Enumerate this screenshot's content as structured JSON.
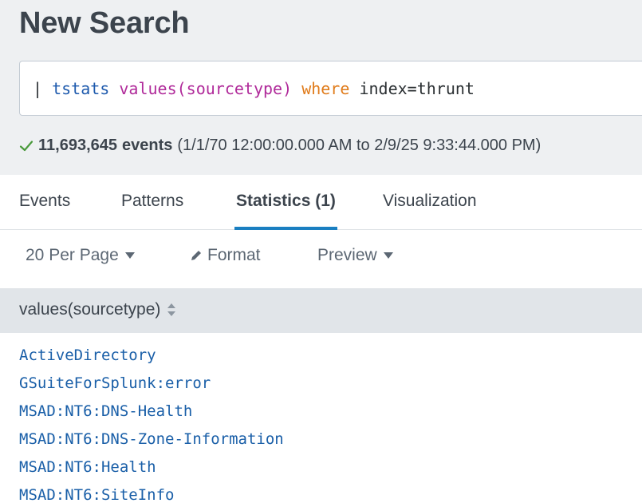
{
  "header": {
    "title": "New Search"
  },
  "search": {
    "pipe": "|",
    "command": "tstats",
    "function": "values(sourcetype)",
    "keyword": "where",
    "argument": "index=thrunt"
  },
  "status": {
    "count": "11,693,645",
    "events_word": "events",
    "range": "(1/1/70 12:00:00.000 AM to 2/9/25 9:33:44.000 PM)"
  },
  "tabs": [
    {
      "label": "Events"
    },
    {
      "label": "Patterns"
    },
    {
      "label": "Statistics (1)"
    },
    {
      "label": "Visualization"
    }
  ],
  "toolbar": {
    "per_page": "20 Per Page",
    "format": "Format",
    "preview": "Preview"
  },
  "table": {
    "column": "values(sourcetype)",
    "rows": [
      "ActiveDirectory",
      "GSuiteForSplunk:error",
      "MSAD:NT6:DNS-Health",
      "MSAD:NT6:DNS-Zone-Information",
      "MSAD:NT6:Health",
      "MSAD:NT6:SiteInfo"
    ]
  },
  "colors": {
    "accent": "#1a7fc1",
    "success": "#4a9a3c",
    "link": "#1a5fa8"
  }
}
